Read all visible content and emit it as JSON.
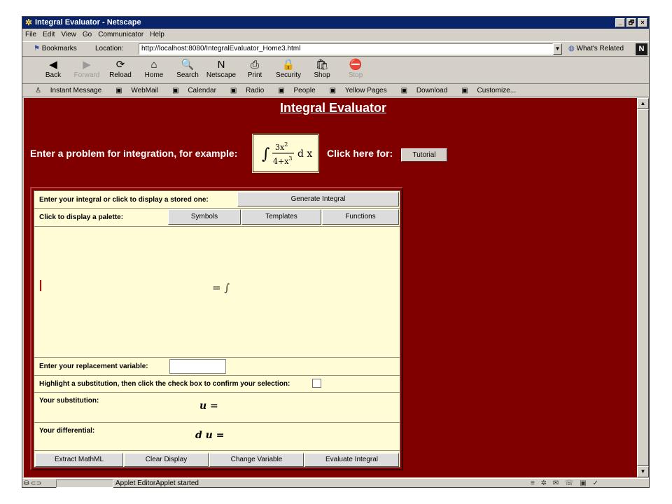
{
  "window": {
    "title": "Integral Evaluator - Netscape",
    "controls": [
      "_",
      "🗗",
      "×"
    ]
  },
  "menu": [
    "File",
    "Edit",
    "View",
    "Go",
    "Communicator",
    "Help"
  ],
  "location_bar": {
    "bookmarks_label": "Bookmarks",
    "location_label": "Location:",
    "url": "http://localhost:8080/IntegralEvaluator_Home3.html",
    "whats_related": "What's Related"
  },
  "nav_toolbar": [
    {
      "label": "Back",
      "icon": "back-arrow-icon",
      "glyph": "◀",
      "enabled": true
    },
    {
      "label": "Forward",
      "icon": "forward-arrow-icon",
      "glyph": "▶",
      "enabled": false
    },
    {
      "label": "Reload",
      "icon": "reload-icon",
      "glyph": "⟳",
      "enabled": true
    },
    {
      "label": "Home",
      "icon": "home-icon",
      "glyph": "⌂",
      "enabled": true
    },
    {
      "label": "Search",
      "icon": "search-icon",
      "glyph": "🔍",
      "enabled": true
    },
    {
      "label": "Netscape",
      "icon": "netscape-icon",
      "glyph": "N",
      "enabled": true
    },
    {
      "label": "Print",
      "icon": "print-icon",
      "glyph": "⎙",
      "enabled": true
    },
    {
      "label": "Security",
      "icon": "lock-icon",
      "glyph": "🔒",
      "enabled": true
    },
    {
      "label": "Shop",
      "icon": "shop-icon",
      "glyph": "🛍",
      "enabled": true
    },
    {
      "label": "Stop",
      "icon": "stop-icon",
      "glyph": "⛔",
      "enabled": false
    }
  ],
  "personal_toolbar": [
    "Instant Message",
    "WebMail",
    "Calendar",
    "Radio",
    "People",
    "Yellow Pages",
    "Download",
    "Customize..."
  ],
  "page": {
    "title": "Integral Evaluator",
    "prompt": "Enter a problem for integration, for example:",
    "example": {
      "num": "3x",
      "num_exp": "2",
      "den": "4+x",
      "den_exp": "3",
      "dvar": "d x"
    },
    "click_here": "Click here for:",
    "tutorial_button": "Tutorial"
  },
  "panel": {
    "integral_label": "Enter your integral or click to display a stored one:",
    "generate_button": "Generate Integral",
    "palette_label": "Click to display a palette:",
    "palette_buttons": [
      "Symbols",
      "Templates",
      "Functions"
    ],
    "editor_expression": "= ∫",
    "replacement_label": "Enter your replacement variable:",
    "replacement_value": "",
    "highlight_label": "Highlight a substitution, then click the check box to confirm your selection:",
    "substitution_label": "Your substitution:",
    "substitution_value": "u =",
    "differential_label": "Your differential:",
    "differential_value": "d u =",
    "bottom_buttons": [
      "Extract MathML",
      "Clear Display",
      "Change Variable",
      "Evaluate Integral"
    ]
  },
  "status": {
    "text": "Applet EditorApplet started"
  },
  "colors": {
    "page_background": "#800000",
    "panel_background": "#fffcd6",
    "title_bar": "#0a246a"
  }
}
